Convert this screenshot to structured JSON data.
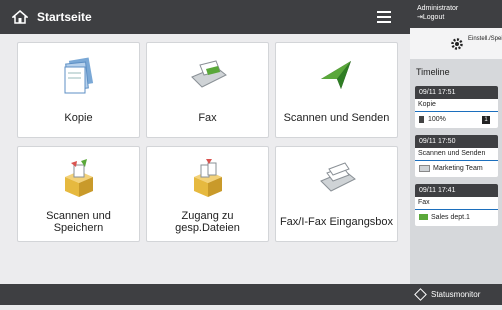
{
  "header": {
    "title": "Startseite"
  },
  "tiles": [
    {
      "label": "Kopie",
      "icon": "copy-icon"
    },
    {
      "label": "Fax",
      "icon": "fax-icon"
    },
    {
      "label": "Scannen und Senden",
      "icon": "scan-send-icon"
    },
    {
      "label": "Scannen und Speichern",
      "icon": "scan-store-icon"
    },
    {
      "label": "Zugang zu gesp.Dateien",
      "icon": "stored-files-icon"
    },
    {
      "label": "Fax/I-Fax Eingangsbox",
      "icon": "fax-inbox-icon"
    }
  ],
  "pager": {
    "prev": "‹",
    "next": "›"
  },
  "side": {
    "user_line1": "Administrator",
    "logout": "Logout",
    "settings_label": "Einstell./Speich.",
    "timeline_title": "Timeline",
    "timeline": [
      {
        "time": "09/11 17:51",
        "name": "Kopie",
        "detail": "100%",
        "extra": "1"
      },
      {
        "time": "09/11 17:50",
        "name": "Scannen und Senden",
        "detail": "Marketing Team"
      },
      {
        "time": "09/11 17:41",
        "name": "Fax",
        "detail": "Sales dept.1"
      }
    ]
  },
  "status_monitor": "Statusmonitor",
  "colors": {
    "header_bg": "#3e3f42",
    "accent_blue": "#1c6fbd",
    "fax_green": "#5aa83a",
    "box_yellow": "#e6b93f"
  }
}
